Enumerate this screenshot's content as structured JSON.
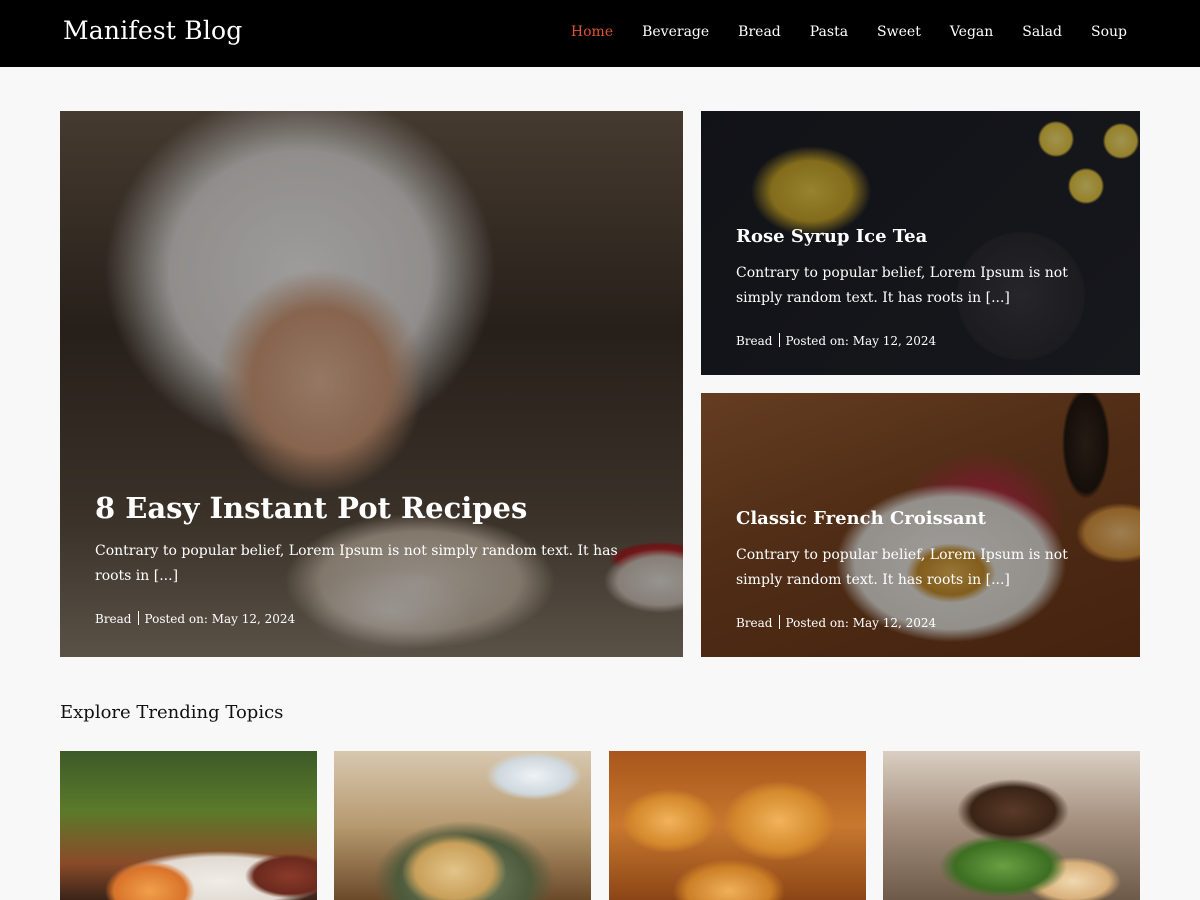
{
  "header": {
    "site_title": "Manifest Blog",
    "nav": [
      {
        "label": "Home",
        "active": true
      },
      {
        "label": "Beverage",
        "active": false
      },
      {
        "label": "Bread",
        "active": false
      },
      {
        "label": "Pasta",
        "active": false
      },
      {
        "label": "Sweet",
        "active": false
      },
      {
        "label": "Vegan",
        "active": false
      },
      {
        "label": "Salad",
        "active": false
      },
      {
        "label": "Soup",
        "active": false
      }
    ],
    "active_color": "#e0532f"
  },
  "featured": [
    {
      "title": "8 Easy Instant Pot Recipes",
      "excerpt": "Contrary to popular belief, Lorem Ipsum is not simply random text. It has roots in [...]",
      "category": "Bread",
      "posted": "Posted on: May 12, 2024"
    },
    {
      "title": "Rose Syrup Ice Tea",
      "excerpt": "Contrary to popular belief, Lorem Ipsum is not simply random text. It has roots in [...]",
      "category": "Bread",
      "posted": "Posted on: May 12, 2024"
    },
    {
      "title": "Classic French Croissant",
      "excerpt": "Contrary to popular belief, Lorem Ipsum is not simply random text. It has roots in [...]",
      "category": "Bread",
      "posted": "Posted on: May 12, 2024"
    }
  ],
  "trending": {
    "heading": "Explore Trending Topics"
  }
}
